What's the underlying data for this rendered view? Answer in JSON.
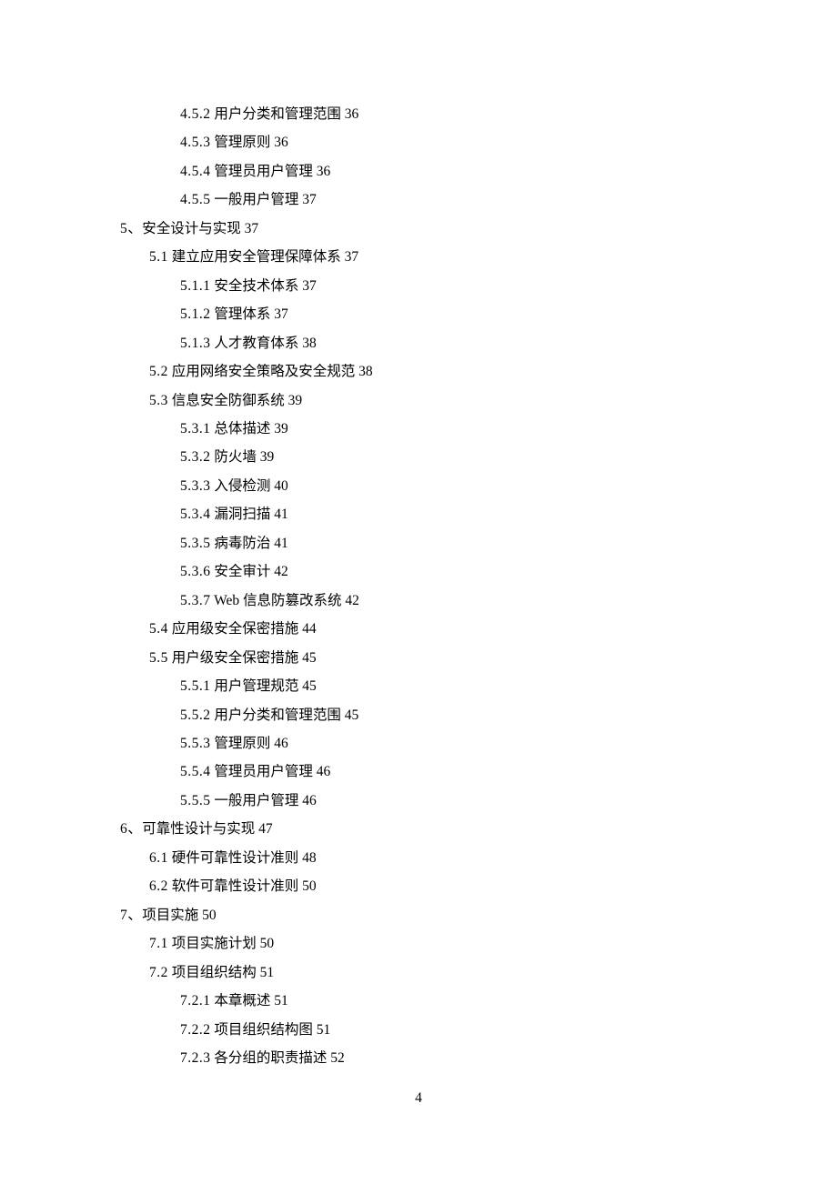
{
  "pageNumber": "4",
  "entries": [
    {
      "indent": 2,
      "num": "4.5.2",
      "title": "用户分类和管理范围",
      "page": "36"
    },
    {
      "indent": 2,
      "num": "4.5.3",
      "title": "管理原则",
      "page": "36"
    },
    {
      "indent": 2,
      "num": "4.5.4",
      "title": "管理员用户管理",
      "page": "36"
    },
    {
      "indent": 2,
      "num": "4.5.5",
      "title": "一般用户管理",
      "page": "37"
    },
    {
      "indent": 0,
      "num": "5、",
      "title": "安全设计与实现",
      "page": "37"
    },
    {
      "indent": 1,
      "num": "5.1",
      "title": "建立应用安全管理保障体系",
      "page": "37"
    },
    {
      "indent": 2,
      "num": "5.1.1",
      "title": "安全技术体系",
      "page": "37"
    },
    {
      "indent": 2,
      "num": "5.1.2",
      "title": "管理体系",
      "page": "37"
    },
    {
      "indent": 2,
      "num": "5.1.3",
      "title": "人才教育体系",
      "page": "38"
    },
    {
      "indent": 1,
      "num": "5.2",
      "title": "应用网络安全策略及安全规范",
      "page": "38"
    },
    {
      "indent": 1,
      "num": "5.3",
      "title": "信息安全防御系统",
      "page": "39"
    },
    {
      "indent": 2,
      "num": "5.3.1",
      "title": "总体描述",
      "page": "39"
    },
    {
      "indent": 2,
      "num": "5.3.2",
      "title": "防火墙",
      "page": "39"
    },
    {
      "indent": 2,
      "num": "5.3.3",
      "title": "入侵检测",
      "page": "40"
    },
    {
      "indent": 2,
      "num": "5.3.4",
      "title": "漏洞扫描",
      "page": "41"
    },
    {
      "indent": 2,
      "num": "5.3.5",
      "title": "病毒防治",
      "page": "41"
    },
    {
      "indent": 2,
      "num": "5.3.6",
      "title": "安全审计",
      "page": "42"
    },
    {
      "indent": 2,
      "num": "5.3.7",
      "title": "Web 信息防篡改系统",
      "page": "42"
    },
    {
      "indent": 1,
      "num": "5.4",
      "title": "应用级安全保密措施",
      "page": "44"
    },
    {
      "indent": 1,
      "num": "5.5",
      "title": "用户级安全保密措施",
      "page": "45"
    },
    {
      "indent": 2,
      "num": "5.5.1",
      "title": "用户管理规范",
      "page": "45"
    },
    {
      "indent": 2,
      "num": "5.5.2",
      "title": "用户分类和管理范围",
      "page": "45"
    },
    {
      "indent": 2,
      "num": "5.5.3",
      "title": "管理原则",
      "page": "46"
    },
    {
      "indent": 2,
      "num": "5.5.4",
      "title": "管理员用户管理",
      "page": "46"
    },
    {
      "indent": 2,
      "num": "5.5.5",
      "title": "一般用户管理",
      "page": "46"
    },
    {
      "indent": 0,
      "num": "6、",
      "title": "可靠性设计与实现",
      "page": "47"
    },
    {
      "indent": 1,
      "num": "6.1",
      "title": "硬件可靠性设计准则",
      "page": "48"
    },
    {
      "indent": 1,
      "num": "6.2",
      "title": "软件可靠性设计准则",
      "page": "50"
    },
    {
      "indent": 0,
      "num": "7、",
      "title": "项目实施",
      "page": "50"
    },
    {
      "indent": 1,
      "num": "7.1",
      "title": "项目实施计划",
      "page": "50"
    },
    {
      "indent": 1,
      "num": "7.2",
      "title": "项目组织结构",
      "page": "51"
    },
    {
      "indent": 2,
      "num": "7.2.1",
      "title": "本章概述",
      "page": "51"
    },
    {
      "indent": 2,
      "num": "7.2.2",
      "title": "项目组织结构图",
      "page": "51"
    },
    {
      "indent": 2,
      "num": "7.2.3",
      "title": "各分组的职责描述",
      "page": "52"
    }
  ]
}
